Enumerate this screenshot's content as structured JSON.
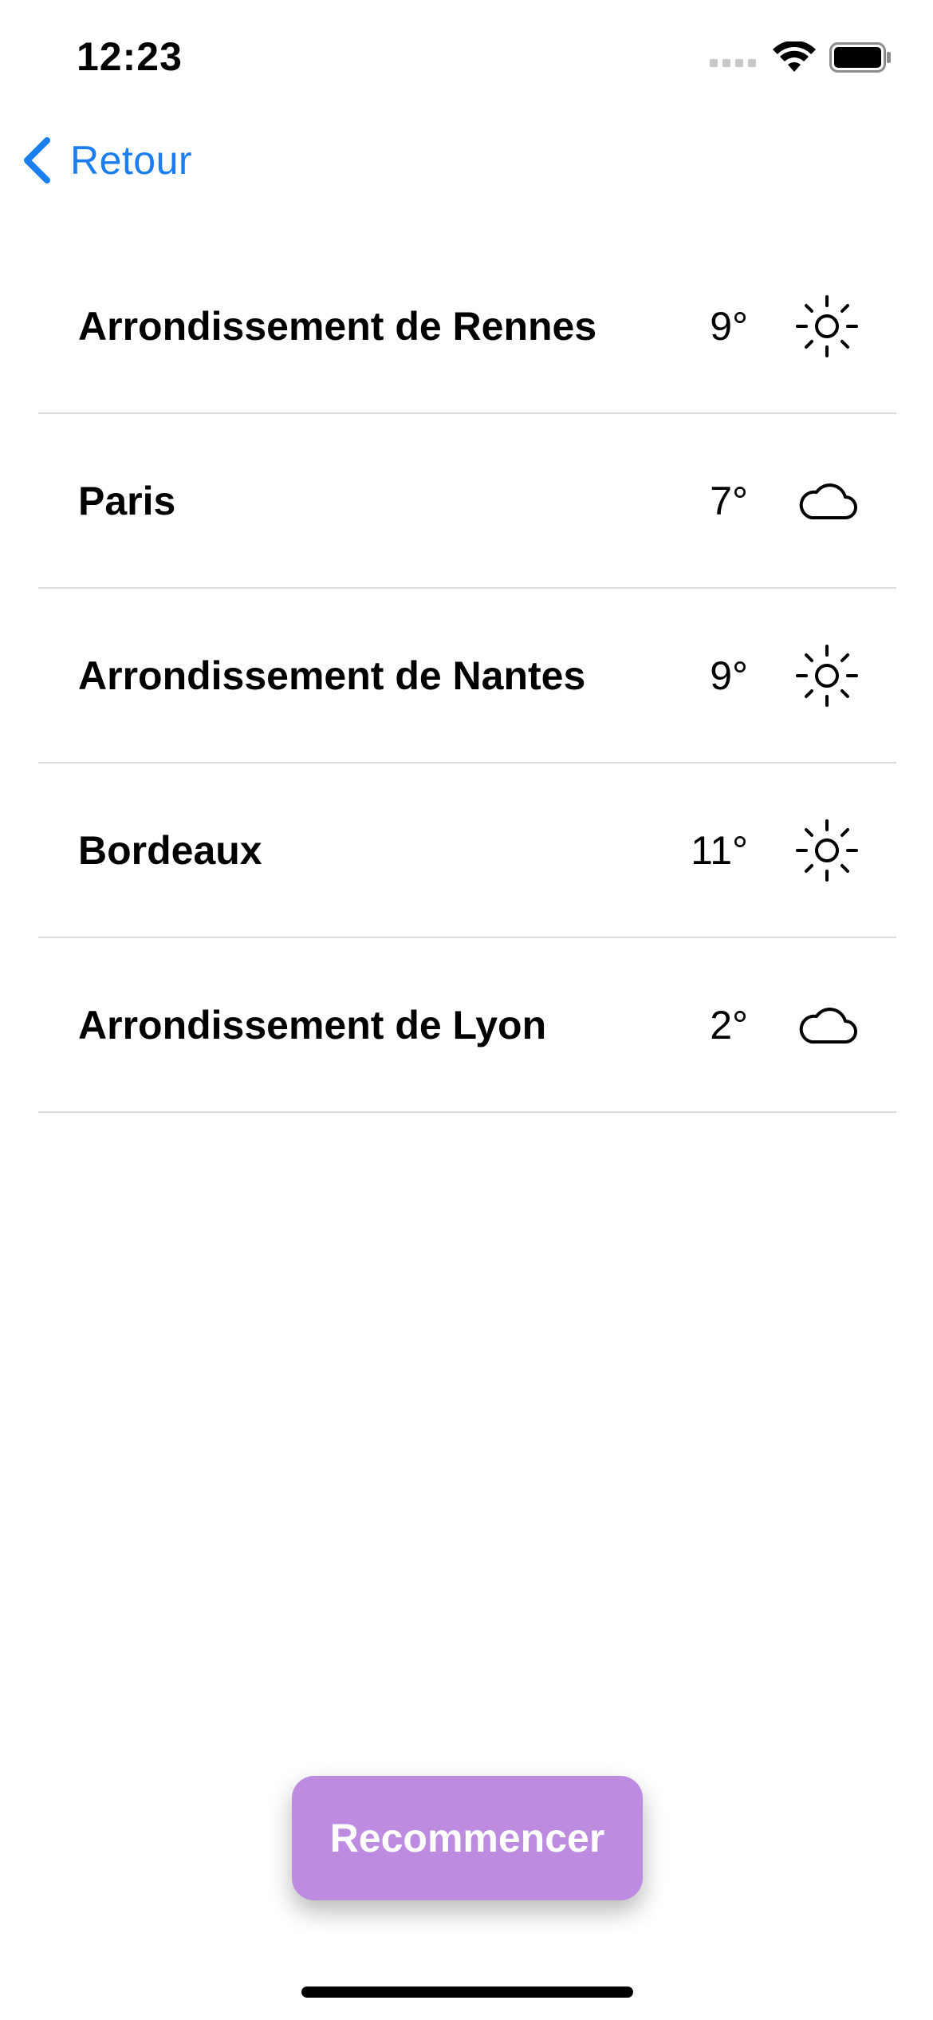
{
  "status_bar": {
    "time": "12:23",
    "icons": [
      "cellular-signal-icon",
      "wifi-icon",
      "battery-icon"
    ]
  },
  "nav": {
    "back_label": "Retour",
    "back_icon": "chevron-left-icon",
    "accent_color": "#1a7ef0"
  },
  "cities": [
    {
      "name": "Arrondissement de Rennes",
      "temp": "9°",
      "icon": "sun-icon"
    },
    {
      "name": "Paris",
      "temp": "7°",
      "icon": "cloud-icon"
    },
    {
      "name": "Arrondissement de Nantes",
      "temp": "9°",
      "icon": "sun-icon"
    },
    {
      "name": "Bordeaux",
      "temp": "11°",
      "icon": "sun-icon"
    },
    {
      "name": "Arrondissement de Lyon",
      "temp": "2°",
      "icon": "cloud-icon"
    }
  ],
  "restart_button": {
    "label": "Recommencer",
    "color": "#bd8ce1"
  }
}
